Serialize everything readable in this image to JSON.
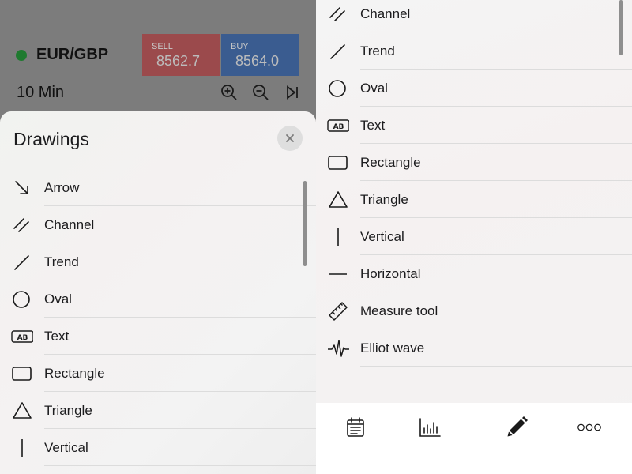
{
  "header": {
    "pair": "EUR/GBP",
    "status_color": "#1f7a2f",
    "sell": {
      "label": "SELL",
      "value": "8562.7"
    },
    "buy": {
      "label": "BUY",
      "value": "8564.0"
    },
    "timeframe": "10 Min"
  },
  "sheet": {
    "title": "Drawings",
    "items": [
      {
        "label": "Arrow",
        "icon": "arrow-down-right-icon"
      },
      {
        "label": "Channel",
        "icon": "channel-icon"
      },
      {
        "label": "Trend",
        "icon": "trend-line-icon"
      },
      {
        "label": "Oval",
        "icon": "oval-icon"
      },
      {
        "label": "Text",
        "icon": "text-ab-icon"
      },
      {
        "label": "Rectangle",
        "icon": "rectangle-icon"
      },
      {
        "label": "Triangle",
        "icon": "triangle-icon"
      },
      {
        "label": "Vertical",
        "icon": "vertical-line-icon"
      }
    ]
  },
  "right_list": {
    "items": [
      {
        "label": "Channel",
        "icon": "channel-icon"
      },
      {
        "label": "Trend",
        "icon": "trend-line-icon"
      },
      {
        "label": "Oval",
        "icon": "oval-icon"
      },
      {
        "label": "Text",
        "icon": "text-ab-icon"
      },
      {
        "label": "Rectangle",
        "icon": "rectangle-icon"
      },
      {
        "label": "Triangle",
        "icon": "triangle-icon"
      },
      {
        "label": "Vertical",
        "icon": "vertical-line-icon"
      },
      {
        "label": "Horizontal",
        "icon": "horizontal-line-icon"
      },
      {
        "label": "Measure tool",
        "icon": "ruler-icon"
      },
      {
        "label": "Elliot wave",
        "icon": "wave-icon"
      }
    ]
  },
  "tabbar": {
    "tabs": [
      {
        "name": "calendar-tab",
        "icon": "calendar-icon"
      },
      {
        "name": "indicators-tab",
        "icon": "bar-chart-icon"
      },
      {
        "name": "drawings-tab",
        "icon": "pencil-icon",
        "active": true
      },
      {
        "name": "more-tab",
        "icon": "more-dots-icon"
      }
    ]
  },
  "colors": {
    "sell_bg": "#9b4a4c",
    "buy_bg": "#3a5c90",
    "sheet_bg": "#f2f2f2",
    "text": "#1c1c1e"
  }
}
